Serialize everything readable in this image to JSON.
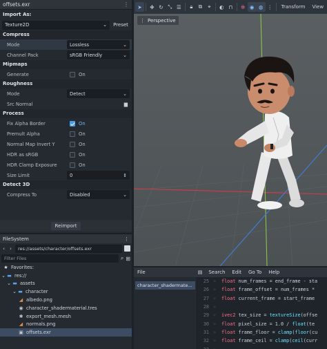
{
  "import_panel": {
    "file_title": "offsets.exr",
    "menu_icon": "three-dots-icon",
    "import_as_label": "Import As:",
    "import_as_value": "Texture2D",
    "preset_label": "Preset",
    "sections": {
      "compress": "Compress",
      "mipmaps": "Mipmaps",
      "roughness": "Roughness",
      "process": "Process",
      "detect3d": "Detect 3D"
    },
    "compress_mode_label": "Mode",
    "compress_mode_value": "Lossless",
    "channel_pack_label": "Channel Pack",
    "channel_pack_value": "sRGB Friendly",
    "generate_label": "Generate",
    "generate_value": "On",
    "roughness_mode_label": "Mode",
    "roughness_mode_value": "Detect",
    "src_normal_label": "Src Normal",
    "fix_alpha_label": "Fix Alpha Border",
    "fix_alpha_value": "On",
    "premult_label": "Premult Alpha",
    "premult_value": "On",
    "normal_invert_label": "Normal Map Invert Y",
    "normal_invert_value": "On",
    "hdr_srgb_label": "HDR as sRGB",
    "hdr_srgb_value": "On",
    "hdr_clamp_label": "HDR Clamp Exposure",
    "hdr_clamp_value": "On",
    "size_limit_label": "Size Limit",
    "size_limit_value": "0",
    "compress_to_label": "Compress To",
    "compress_to_value": "Disabled",
    "reimport_label": "Reimport"
  },
  "filesystem": {
    "title": "FileSystem",
    "path": "res://assets/character/offsets.exr",
    "filter_placeholder": "Filter Files",
    "favorites": "Favorites:",
    "items": [
      {
        "label": "res://",
        "depth": 0
      },
      {
        "label": "assets",
        "depth": 1
      },
      {
        "label": "character",
        "depth": 2
      },
      {
        "label": "albedo.png",
        "depth": 3
      },
      {
        "label": "character_shadermaterial.tres",
        "depth": 3
      },
      {
        "label": "export_mesh.mesh",
        "depth": 3
      },
      {
        "label": "normals.png",
        "depth": 3
      },
      {
        "label": "offsets.exr",
        "depth": 3
      }
    ]
  },
  "toolbar": {
    "transform_label": "Transform",
    "view_label": "View"
  },
  "viewport": {
    "perspective_label": "Perspective"
  },
  "script_editor": {
    "menu": [
      "File",
      "Search",
      "Edit",
      "Go To",
      "Help"
    ],
    "open_script": "character_shadermate...",
    "lines": [
      {
        "n": "25",
        "code": [
          [
            "kw",
            "float"
          ],
          [
            "id",
            " num_frames = end_frame - sta"
          ]
        ]
      },
      {
        "n": "26",
        "code": [
          [
            "kw",
            "float"
          ],
          [
            "id",
            " frame_offset = num_frames *"
          ]
        ]
      },
      {
        "n": "27",
        "code": [
          [
            "kw",
            "float"
          ],
          [
            "id",
            " current_frame = start_frame "
          ]
        ]
      },
      {
        "n": "28",
        "code": []
      },
      {
        "n": "29",
        "code": [
          [
            "kw",
            "ivec2"
          ],
          [
            "id",
            " tex_size = "
          ],
          [
            "fn",
            "textureSize"
          ],
          [
            "id",
            "(offse"
          ]
        ]
      },
      {
        "n": "30",
        "code": [
          [
            "kw",
            "float"
          ],
          [
            "id",
            " pixel_size = 1.0 / "
          ],
          [
            "fn",
            "float"
          ],
          [
            "id",
            "(te"
          ]
        ]
      },
      {
        "n": "31",
        "code": [
          [
            "kw",
            "float"
          ],
          [
            "id",
            " frame_floor = "
          ],
          [
            "fn",
            "clamp"
          ],
          [
            "id",
            "("
          ],
          [
            "fn",
            "floor"
          ],
          [
            "id",
            "(cu"
          ]
        ]
      },
      {
        "n": "32",
        "code": [
          [
            "kw",
            "float"
          ],
          [
            "id",
            " frame_ceil = "
          ],
          [
            "fn",
            "clamp"
          ],
          [
            "id",
            "("
          ],
          [
            "fn",
            "ceil"
          ],
          [
            "id",
            "(curr"
          ]
        ]
      },
      {
        "n": "33",
        "code": []
      }
    ]
  }
}
